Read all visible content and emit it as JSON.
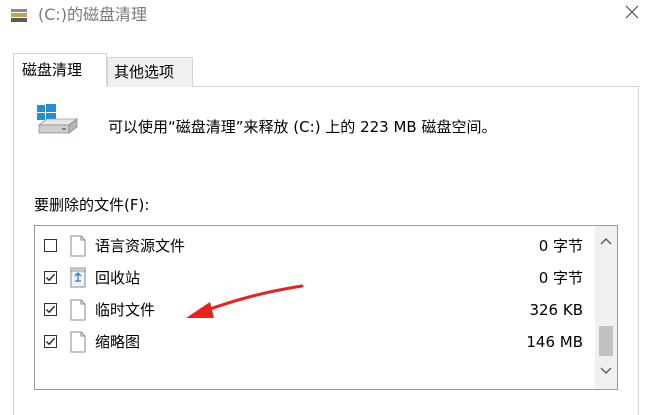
{
  "window": {
    "title": "(C:)的磁盘清理"
  },
  "tabs": [
    {
      "label": "磁盘清理",
      "active": true
    },
    {
      "label": "其他选项",
      "active": false
    }
  ],
  "info": {
    "message": "可以使用“磁盘清理”来释放 (C:) 上的 223 MB 磁盘空间。"
  },
  "files_section": {
    "label": "要删除的文件(F):"
  },
  "files": [
    {
      "name": "语言资源文件",
      "size": "0 字节",
      "checked": false,
      "icon": "file-icon"
    },
    {
      "name": "回收站",
      "size": "0 字节",
      "checked": true,
      "icon": "recycle-bin-icon"
    },
    {
      "name": "临时文件",
      "size": "326 KB",
      "checked": true,
      "icon": "file-icon"
    },
    {
      "name": "缩略图",
      "size": "146 MB",
      "checked": true,
      "icon": "file-icon"
    }
  ],
  "colors": {
    "annotation_arrow": "#e8231d",
    "windows_blue": "#1e90d6"
  }
}
